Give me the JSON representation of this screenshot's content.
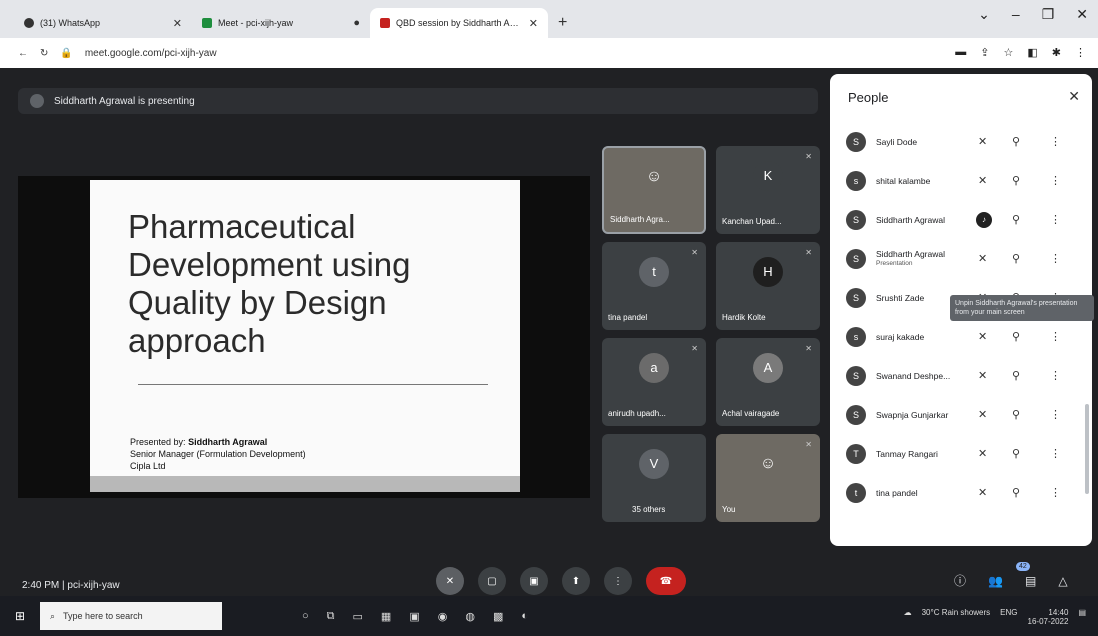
{
  "browser": {
    "tabs": [
      {
        "label": "(31) WhatsApp",
        "active": false
      },
      {
        "label": "Meet - pci-xijh-yaw",
        "active": false
      },
      {
        "label": "QBD session by Siddharth Agrav",
        "active": true
      }
    ],
    "new_tab": "+",
    "url": "meet.google.com/pci-xijh-yaw"
  },
  "meet": {
    "presenting_text": "Siddharth Agrawal is presenting",
    "meeting_time": "2:40 PM",
    "meeting_code": "pci-xijh-yaw",
    "slide": {
      "title": "Pharmaceutical Development using Quality by Design approach",
      "presented_by_label": "Presented by:",
      "presenter": "Siddharth Agrawal",
      "role": "Senior Manager (Formulation Development)",
      "company": "Cipla Ltd"
    },
    "tiles": [
      {
        "name": "Siddharth Agra...",
        "type": "video"
      },
      {
        "name": "Kanchan Upad...",
        "initial": "K"
      },
      {
        "name": "tina pandel",
        "initial": "t"
      },
      {
        "name": "Hardik Kolte",
        "initial": "H"
      },
      {
        "name": "anirudh upadh...",
        "initial": "a"
      },
      {
        "name": "Achal vairagade",
        "initial": "A"
      },
      {
        "name": "35 others",
        "initial": "V"
      },
      {
        "name": "You",
        "type": "video"
      }
    ],
    "participant_badge": "42"
  },
  "people": {
    "title": "People",
    "tooltip": "Unpin Siddharth Agrawal's presentation from your main screen",
    "rows": [
      {
        "name": "Sayli Dode",
        "initial": "S"
      },
      {
        "name": "shital kalambe",
        "initial": "s"
      },
      {
        "name": "Siddharth Agrawal",
        "initial": "S",
        "speaking": true
      },
      {
        "name": "Siddharth Agrawal",
        "sub": "Presentation",
        "initial": "S"
      },
      {
        "name": "Srushti Zade",
        "initial": "S"
      },
      {
        "name": "suraj kakade",
        "initial": "s"
      },
      {
        "name": "Swanand Deshpe...",
        "initial": "S"
      },
      {
        "name": "Swapnja Gunjarkar",
        "initial": "S"
      },
      {
        "name": "Tanmay Rangari",
        "initial": "T"
      },
      {
        "name": "tina pandel",
        "initial": "t"
      }
    ]
  },
  "taskbar": {
    "search_placeholder": "Type here to search",
    "weather": "30°C Rain showers",
    "time": "14:40",
    "date": "16-07-2022",
    "lang": "ENG"
  }
}
